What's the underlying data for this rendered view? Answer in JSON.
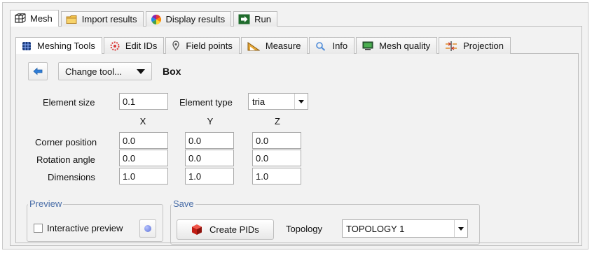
{
  "top_tabs": [
    {
      "label": "Mesh",
      "icon": "mesh-icon",
      "active": true
    },
    {
      "label": "Import results",
      "icon": "folder-icon",
      "active": false
    },
    {
      "label": "Display results",
      "icon": "color-wheel-icon",
      "active": false
    },
    {
      "label": "Run",
      "icon": "run-arrow-icon",
      "active": false
    }
  ],
  "sub_tabs": [
    {
      "label": "Meshing Tools",
      "icon": "meshing-tools-icon",
      "active": true
    },
    {
      "label": "Edit IDs",
      "icon": "edit-ids-icon",
      "active": false
    },
    {
      "label": "Field points",
      "icon": "field-points-icon",
      "active": false
    },
    {
      "label": "Measure",
      "icon": "measure-icon",
      "active": false
    },
    {
      "label": "Info",
      "icon": "info-icon",
      "active": false
    },
    {
      "label": "Mesh quality",
      "icon": "mesh-quality-icon",
      "active": false
    },
    {
      "label": "Projection",
      "icon": "projection-icon",
      "active": false
    }
  ],
  "toolbar": {
    "back_icon": "back-arrow-icon",
    "change_tool_label": "Change tool...",
    "tool_title": "Box"
  },
  "element": {
    "size_label": "Element size",
    "size_value": "0.1",
    "type_label": "Element type",
    "type_value": "tria"
  },
  "columns": [
    "X",
    "Y",
    "Z"
  ],
  "rows": [
    {
      "label": "Corner position",
      "values": [
        "0.0",
        "0.0",
        "0.0"
      ]
    },
    {
      "label": "Rotation angle",
      "values": [
        "0.0",
        "0.0",
        "0.0"
      ]
    },
    {
      "label": "Dimensions",
      "values": [
        "1.0",
        "1.0",
        "1.0"
      ]
    }
  ],
  "preview": {
    "group_title": "Preview",
    "checkbox_label": "Interactive preview",
    "checked": false
  },
  "save": {
    "group_title": "Save",
    "create_label": "Create PIDs",
    "topology_label": "Topology",
    "topology_value": "TOPOLOGY 1"
  },
  "colors": {
    "accent_blue": "#2f7ed8",
    "group_title": "#4a6ea8",
    "create_red": "#d9251d",
    "panel_bg": "#f2f2f2"
  }
}
